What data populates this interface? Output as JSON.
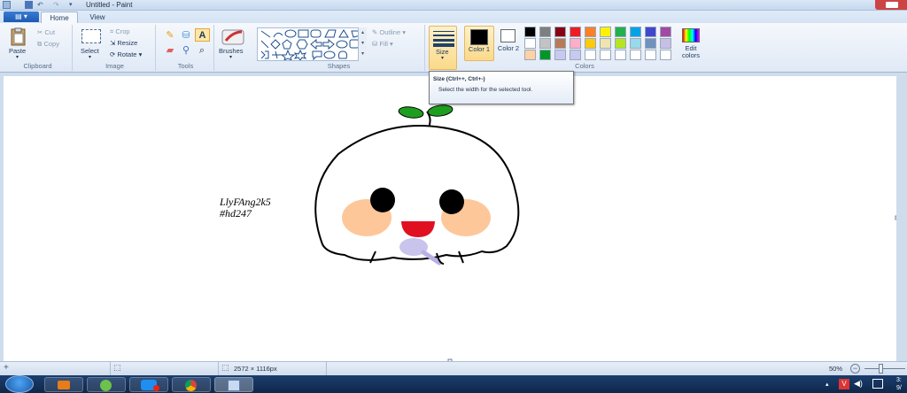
{
  "window": {
    "title": "Untitled - Paint"
  },
  "tabs": {
    "file": "▤ ▾",
    "home": "Home",
    "view": "View"
  },
  "clipboard": {
    "paste": "Paste",
    "cut": "Cut",
    "copy": "Copy",
    "group": "Clipboard"
  },
  "image": {
    "select": "Select",
    "crop": "Crop",
    "resize": "Resize",
    "rotate": "Rotate",
    "group": "Image"
  },
  "tools": {
    "group": "Tools"
  },
  "brushes": {
    "label": "Brushes"
  },
  "shapes": {
    "group": "Shapes",
    "outline": "Outline",
    "fill": "Fill"
  },
  "size": {
    "label": "Size"
  },
  "colors": {
    "color1": "Color 1",
    "color2": "Color 2",
    "edit": "Edit colors",
    "group": "Colors",
    "color1_value": "#000000",
    "color2_value": "#ffffff",
    "palette": [
      "#000000",
      "#7f7f7f",
      "#880015",
      "#ed1c24",
      "#ff7f27",
      "#fff200",
      "#22b14c",
      "#00a2e8",
      "#3f48cc",
      "#a349a4",
      "#ffffff",
      "#c3c3c3",
      "#b97a57",
      "#ffaec9",
      "#ffc90e",
      "#efe4b0",
      "#b5e61d",
      "#99d9ea",
      "#7092be",
      "#c8bfe7",
      "#ffd1a3",
      "#009628",
      "#c8c8f0",
      "#c8c8f0",
      "#ffffff",
      "#ffffff",
      "#ffffff",
      "#ffffff",
      "#ffffff",
      "#ffffff"
    ]
  },
  "tooltip": {
    "title": "Size (Ctrl++, Ctrl+-)",
    "body": "Select the width for the selected tool."
  },
  "drawing": {
    "line1": "LlyFAng2k5",
    "line2": "#hd247"
  },
  "status": {
    "dimensions": "2572 × 1116px",
    "zoom": "50%"
  },
  "taskbar": {
    "time": "3:",
    "date": "9/"
  }
}
